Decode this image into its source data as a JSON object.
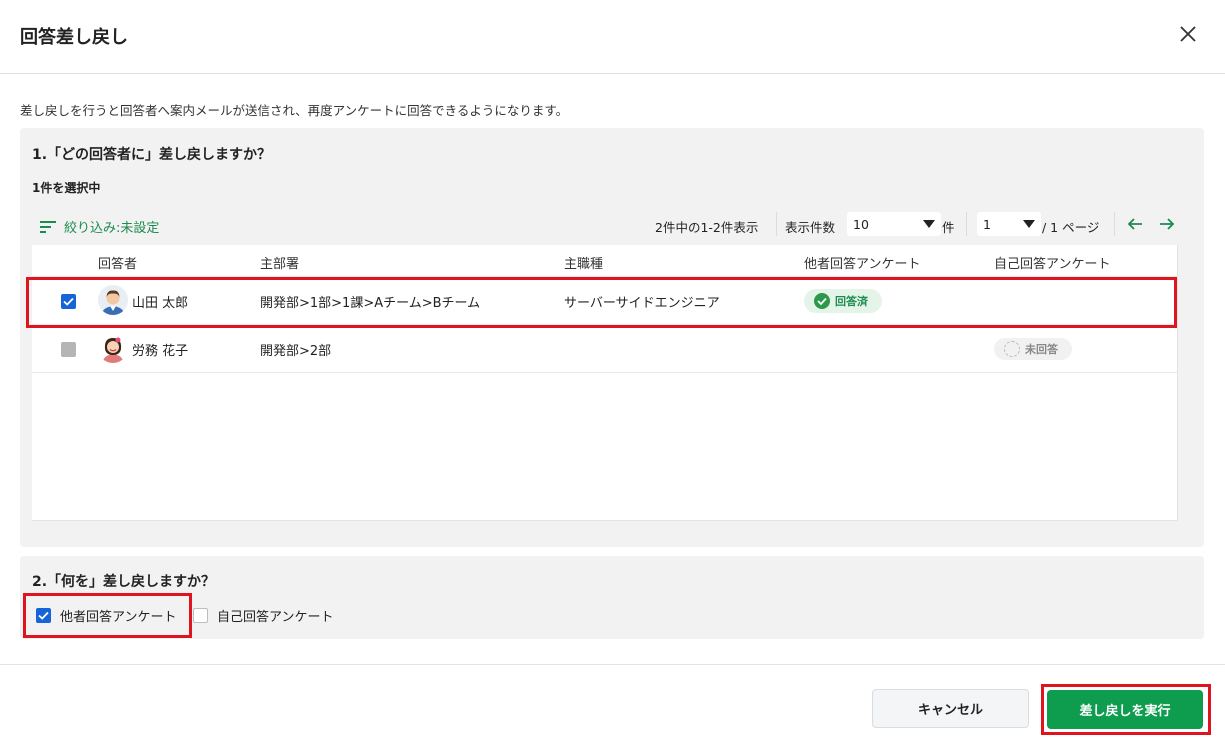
{
  "dialog": {
    "title": "回答差し戻し",
    "description": "差し戻しを行うと回答者へ案内メールが送信され、再度アンケートに回答できるようになります。"
  },
  "section1": {
    "heading": "1.「どの回答者に」差し戻しますか？",
    "selected_count": "1件を選択中",
    "filter_label": "絞り込み:未設定",
    "range_text": "2件中の1-2件表示",
    "page_size_label": "表示件数",
    "page_size_value": "10",
    "page_size_unit": "件",
    "page_value": "1",
    "page_suffix": "/ 1 ページ",
    "columns": [
      "回答者",
      "主部署",
      "主職種",
      "他者回答アンケート",
      "自己回答アンケート"
    ],
    "rows": [
      {
        "checked": true,
        "name": "山田 太郎",
        "department": "開発部>1部>1課>Aチーム>Bチーム",
        "job": "サーバーサイドエンジニア",
        "other_status": "回答済",
        "self_status": ""
      },
      {
        "checked": false,
        "name": "労務 花子",
        "department": "開発部>2部",
        "job": "",
        "other_status": "",
        "self_status": "未回答"
      }
    ]
  },
  "section2": {
    "heading": "2.「何を」差し戻しますか？",
    "options": [
      {
        "label": "他者回答アンケート",
        "checked": true
      },
      {
        "label": "自己回答アンケート",
        "checked": false
      }
    ]
  },
  "footer": {
    "cancel_label": "キャンセル",
    "execute_label": "差し戻しを実行"
  },
  "colors": {
    "accent_green": "#0e9c4e",
    "checkbox_blue": "#1565d8",
    "highlight_red": "#e0141e"
  }
}
